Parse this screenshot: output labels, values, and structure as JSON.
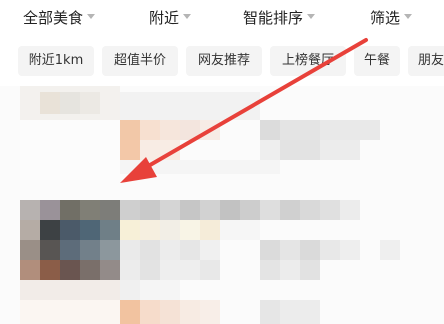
{
  "filter_bar": {
    "items": [
      {
        "label": "全部美食"
      },
      {
        "label": "附近"
      },
      {
        "label": "智能排序"
      },
      {
        "label": "筛选"
      }
    ]
  },
  "chips": [
    {
      "label": "附近1km"
    },
    {
      "label": "超值半价"
    },
    {
      "label": "网友推荐"
    },
    {
      "label": "上榜餐厅"
    },
    {
      "label": "午餐"
    },
    {
      "label": "朋友"
    }
  ],
  "colors": {
    "annotation_arrow": "#e8413a",
    "chip_bg": "#f4f4f4",
    "caret": "#b5b5b5"
  },
  "icons": {
    "dropdown": "caret-down-icon",
    "annotation": "red-arrow-annotation"
  }
}
